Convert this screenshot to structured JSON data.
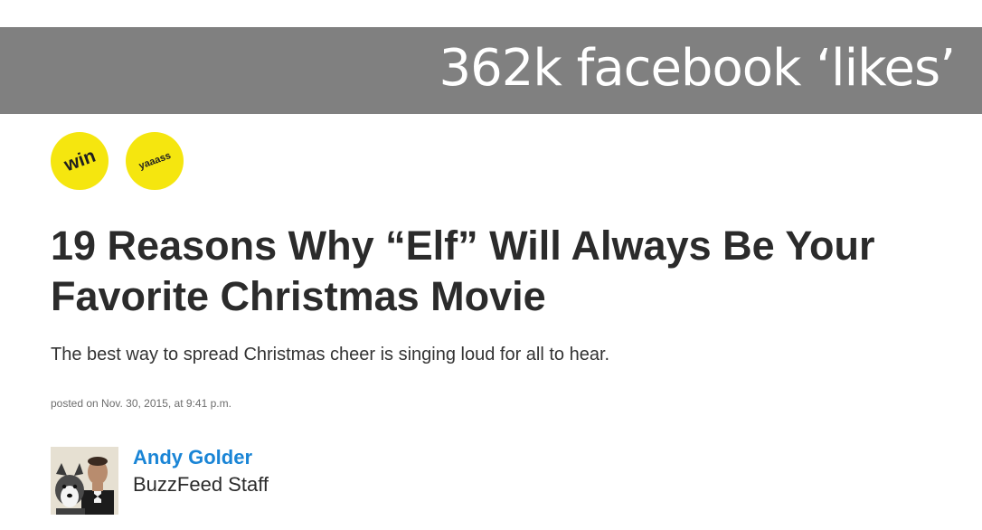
{
  "banner": {
    "text": "362k facebook ‘likes’"
  },
  "badges": [
    {
      "label": "win"
    },
    {
      "label": "yaaass"
    }
  ],
  "article": {
    "headline": "19 Reasons Why “Elf” Will Always Be Your Favorite Christmas Movie",
    "dek": "The best way to spread Christmas cheer is singing loud for all to hear.",
    "posted": "posted on Nov. 30, 2015, at 9:41 p.m."
  },
  "author": {
    "name": "Andy Golder",
    "title": "BuzzFeed Staff"
  },
  "colors": {
    "banner_bg": "#808080",
    "badge_yellow": "#f5e60f",
    "author_link": "#1a85d6",
    "headline": "#2b2b2b"
  }
}
